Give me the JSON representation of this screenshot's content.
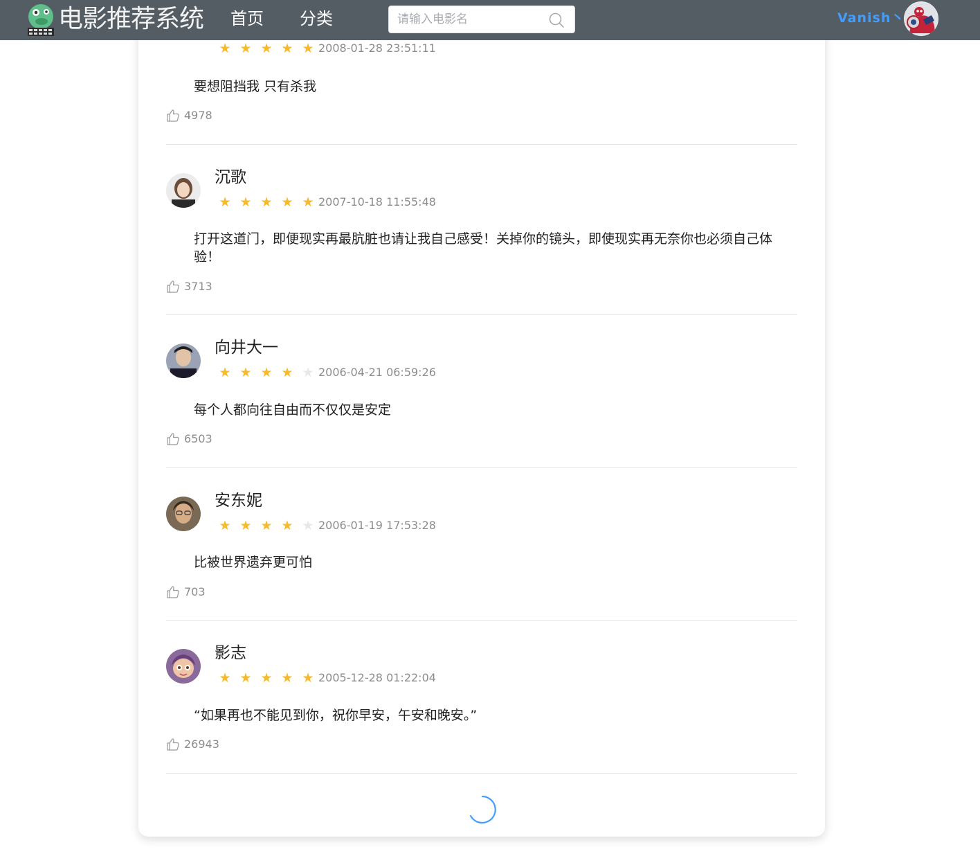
{
  "header": {
    "brand": "电影推荐系统",
    "nav": [
      {
        "label": "首页"
      },
      {
        "label": "分类"
      }
    ],
    "search": {
      "placeholder": "请输入电影名",
      "value": ""
    },
    "user": {
      "name": "Vanish丶"
    }
  },
  "colors": {
    "header_bg": "#545c64",
    "accent": "#409eff",
    "star_on": "#f7ba2a",
    "star_off": "#e6e8eb"
  },
  "reviews": [
    {
      "name": "",
      "rating": 5,
      "time": "2008-01-28 23:51:11",
      "text": "要想阻挡我 只有杀我",
      "likes": "4978"
    },
    {
      "name": "沉歌",
      "rating": 5,
      "time": "2007-10-18 11:55:48",
      "text": "打开这道门，即便现实再最肮脏也请让我自己感受！关掉你的镜头，即使现实再无奈你也必须自己体验！",
      "likes": "3713"
    },
    {
      "name": "向井大一",
      "rating": 4,
      "time": "2006-04-21 06:59:26",
      "text": "每个人都向往自由而不仅仅是安定",
      "likes": "6503"
    },
    {
      "name": "安东妮",
      "rating": 4,
      "time": "2006-01-19 17:53:28",
      "text": "比被世界遗弃更可怕",
      "likes": "703"
    },
    {
      "name": "影志",
      "rating": 5,
      "time": "2005-12-28 01:22:04",
      "text": "“如果再也不能见到你，祝你早安，午安和晚安。”",
      "likes": "26943"
    }
  ]
}
